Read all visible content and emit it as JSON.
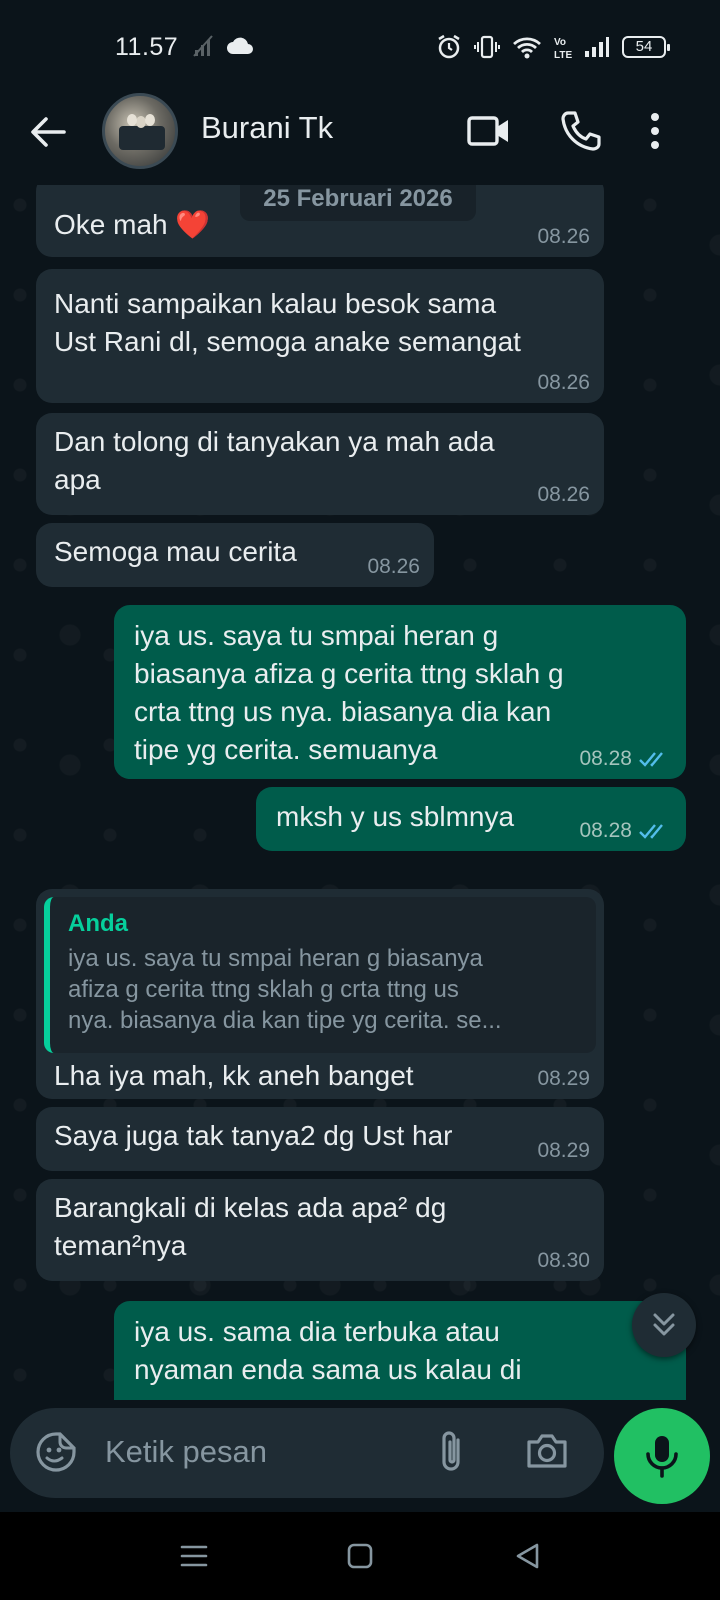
{
  "status_bar": {
    "time": "11.57",
    "battery": "54",
    "network_label": "Vo LTE"
  },
  "header": {
    "contact_name": "Burani Tk"
  },
  "chat": {
    "date_divider": "25 Februari 2026",
    "messages": [
      {
        "direction": "in",
        "text": "Oke mah ❤️",
        "time": "08.26"
      },
      {
        "direction": "in",
        "text": "Nanti sampaikan kalau besok sama\nUst Rani dl, semoga anake semangat",
        "time": "08.26"
      },
      {
        "direction": "in",
        "text": "Dan tolong di tanyakan ya mah ada\napa",
        "time": "08.26"
      },
      {
        "direction": "in",
        "text": "Semoga mau cerita",
        "time": "08.26"
      },
      {
        "direction": "out",
        "text": "iya us. saya tu smpai heran g\nbiasanya afiza g cerita ttng sklah g\ncrta ttng us nya. biasanya dia kan\ntipe yg cerita. semuanya",
        "time": "08.28",
        "status": "read"
      },
      {
        "direction": "out",
        "text": "mksh y us sblmnya",
        "time": "08.28",
        "status": "read"
      },
      {
        "direction": "in",
        "text": "Lha iya mah, kk aneh banget",
        "time": "08.29",
        "reply_to": {
          "author": "Anda",
          "text": "iya us. saya tu smpai heran g biasanya\nafiza g cerita ttng sklah g crta ttng us\nnya. biasanya dia kan tipe yg cerita. se..."
        }
      },
      {
        "direction": "in",
        "text": "Saya juga tak tanya2 dg Ust har",
        "time": "08.29"
      },
      {
        "direction": "in",
        "text": "Barangkali di kelas ada apa² dg\nteman²nya",
        "time": "08.30"
      },
      {
        "direction": "out",
        "text": "iya us. sama dia terbuka atau\nnyaman enda sama us kalau di",
        "time": "",
        "status": "read"
      }
    ]
  },
  "input": {
    "placeholder": "Ketik pesan"
  },
  "colors": {
    "background": "#0b141a",
    "incoming_bubble": "#1f2c34",
    "outgoing_bubble": "#005c4b",
    "accent_green": "#21c063",
    "read_ticks": "#53bdeb"
  }
}
